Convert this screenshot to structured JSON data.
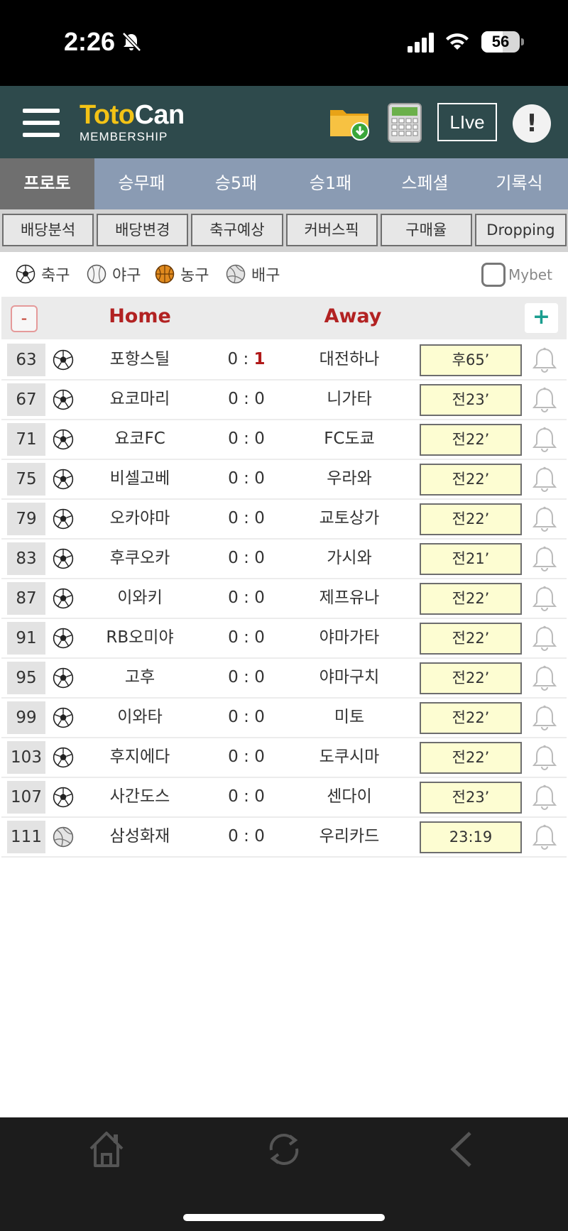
{
  "status_bar": {
    "time": "2:26",
    "battery": "56",
    "battery_level": 0.56
  },
  "app": {
    "logo_main": "Toto",
    "logo_can": "Can",
    "logo_sub": "MEMBERSHIP",
    "live_label": "LIve",
    "alert_label": "!"
  },
  "main_tabs": [
    {
      "label": "프로토",
      "active": true
    },
    {
      "label": "승무패"
    },
    {
      "label": "승5패"
    },
    {
      "label": "승1패"
    },
    {
      "label": "스페셜"
    },
    {
      "label": "기록식"
    }
  ],
  "sub_tabs": [
    "배당분석",
    "배당변경",
    "축구예상",
    "커버스픽",
    "구매율",
    "Dropping"
  ],
  "filters": [
    {
      "label": "축구",
      "icon": "soccer-icon"
    },
    {
      "label": "야구",
      "icon": "baseball-icon"
    },
    {
      "label": "농구",
      "icon": "basketball-icon"
    },
    {
      "label": "배구",
      "icon": "volleyball-icon"
    }
  ],
  "mybet_label": "Mybet",
  "table": {
    "minus": "-",
    "plus": "+",
    "home_header": "Home",
    "away_header": "Away",
    "rows": [
      {
        "num": "63",
        "sport": "soccer",
        "home": "포항스틸",
        "score_home": "0",
        "score_sep": ":",
        "score_away": "1",
        "away": "대전하나",
        "status": "후65’"
      },
      {
        "num": "67",
        "sport": "soccer",
        "home": "요코마리",
        "score_home": "0",
        "score_sep": ":",
        "score_away": "0",
        "away": "니가타",
        "status": "전23’"
      },
      {
        "num": "71",
        "sport": "soccer",
        "home": "요코FC",
        "score_home": "0",
        "score_sep": ":",
        "score_away": "0",
        "away": "FC도쿄",
        "status": "전22’"
      },
      {
        "num": "75",
        "sport": "soccer",
        "home": "비셀고베",
        "score_home": "0",
        "score_sep": ":",
        "score_away": "0",
        "away": "우라와",
        "status": "전22’"
      },
      {
        "num": "79",
        "sport": "soccer",
        "home": "오카야마",
        "score_home": "0",
        "score_sep": ":",
        "score_away": "0",
        "away": "교토상가",
        "status": "전22’"
      },
      {
        "num": "83",
        "sport": "soccer",
        "home": "후쿠오카",
        "score_home": "0",
        "score_sep": ":",
        "score_away": "0",
        "away": "가시와",
        "status": "전21’"
      },
      {
        "num": "87",
        "sport": "soccer",
        "home": "이와키",
        "score_home": "0",
        "score_sep": ":",
        "score_away": "0",
        "away": "제프유나",
        "status": "전22’"
      },
      {
        "num": "91",
        "sport": "soccer",
        "home": "RB오미야",
        "score_home": "0",
        "score_sep": ":",
        "score_away": "0",
        "away": "야마가타",
        "status": "전22’"
      },
      {
        "num": "95",
        "sport": "soccer",
        "home": "고후",
        "score_home": "0",
        "score_sep": ":",
        "score_away": "0",
        "away": "야마구치",
        "status": "전22’"
      },
      {
        "num": "99",
        "sport": "soccer",
        "home": "이와타",
        "score_home": "0",
        "score_sep": ":",
        "score_away": "0",
        "away": "미토",
        "status": "전22’"
      },
      {
        "num": "103",
        "sport": "soccer",
        "home": "후지에다",
        "score_home": "0",
        "score_sep": ":",
        "score_away": "0",
        "away": "도쿠시마",
        "status": "전22’"
      },
      {
        "num": "107",
        "sport": "soccer",
        "home": "사간도스",
        "score_home": "0",
        "score_sep": ":",
        "score_away": "0",
        "away": "센다이",
        "status": "전23’"
      },
      {
        "num": "111",
        "sport": "volleyball",
        "home": "삼성화재",
        "score_home": "0",
        "score_sep": ":",
        "score_away": "0",
        "away": "우리카드",
        "status": "23:19"
      }
    ]
  },
  "colors": {
    "header_bg": "#2e4a4c",
    "tab_bg": "#8a9bb3",
    "tab_active": "#6f6f6f",
    "accent_red": "#b22222",
    "status_bg": "#fdfdd2",
    "logo_yellow": "#f3c316"
  }
}
